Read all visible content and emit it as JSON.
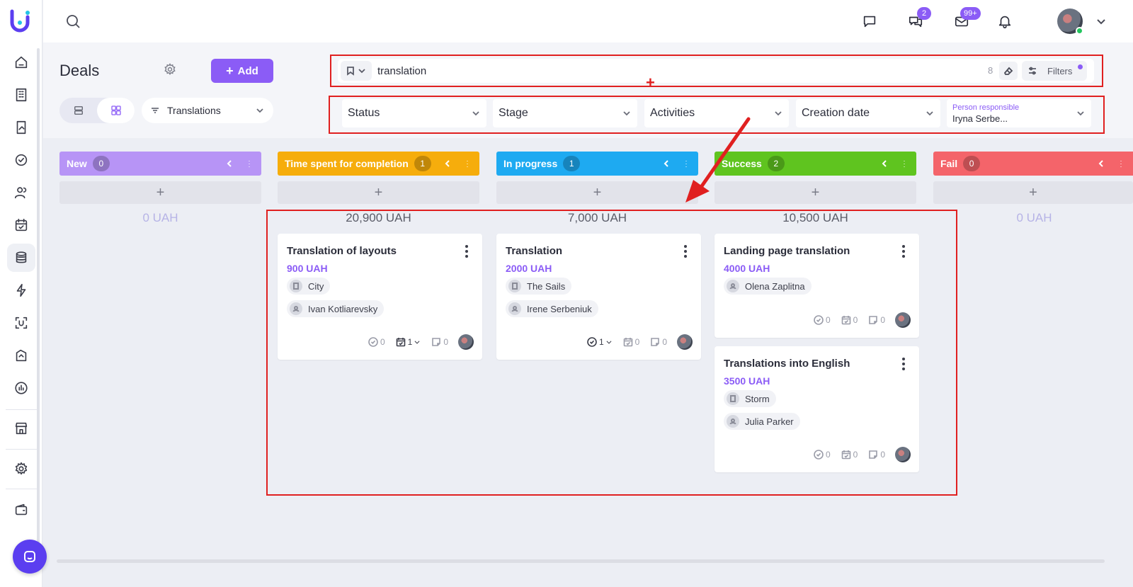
{
  "topbar": {
    "chat_badge": "2",
    "mail_badge": "99+"
  },
  "header": {
    "title": "Deals",
    "add_label": "Add",
    "pipeline": "Translations"
  },
  "search": {
    "value": "translation",
    "count": "8",
    "filters_label": "Filters"
  },
  "filters": {
    "status": "Status",
    "stage": "Stage",
    "activities": "Activities",
    "creation_date": "Creation date",
    "person_label": "Person responsible",
    "person_value": "Iryna Serbe..."
  },
  "columns": [
    {
      "name": "New",
      "count": "0",
      "total": "0 UAH",
      "color": "#b794f6"
    },
    {
      "name": "Time spent for completion",
      "count": "1",
      "total": "20,900 UAH",
      "color": "#f6ad0c"
    },
    {
      "name": "In progress",
      "count": "1",
      "total": "7,000 UAH",
      "color": "#1eaaf1"
    },
    {
      "name": "Success",
      "count": "2",
      "total": "10,500 UAH",
      "color": "#5fc41f"
    },
    {
      "name": "Fail",
      "count": "0",
      "total": "0 UAH",
      "color": "#f4646a"
    }
  ],
  "cards": [
    {
      "title": "Translation of layouts",
      "amount": "900 UAH",
      "company": "City",
      "person": "Ivan Kotliarevsky",
      "tasks": "0",
      "activities": "1",
      "notes": "0"
    },
    {
      "title": "Translation",
      "amount": "2000 UAH",
      "company": "The Sails",
      "person": "Irene Serbeniuk",
      "tasks": "1",
      "activities": "0",
      "notes": "0"
    },
    {
      "title": "Landing page translation",
      "amount": "4000 UAH",
      "person": "Olena Zaplitna",
      "tasks": "0",
      "activities": "0",
      "notes": "0"
    },
    {
      "title": "Translations into English",
      "amount": "3500 UAH",
      "company": "Storm",
      "person": "Julia Parker",
      "tasks": "0",
      "activities": "0",
      "notes": "0"
    }
  ],
  "colors": {
    "accent": "#8b5cf6",
    "annotation": "#e02020"
  }
}
